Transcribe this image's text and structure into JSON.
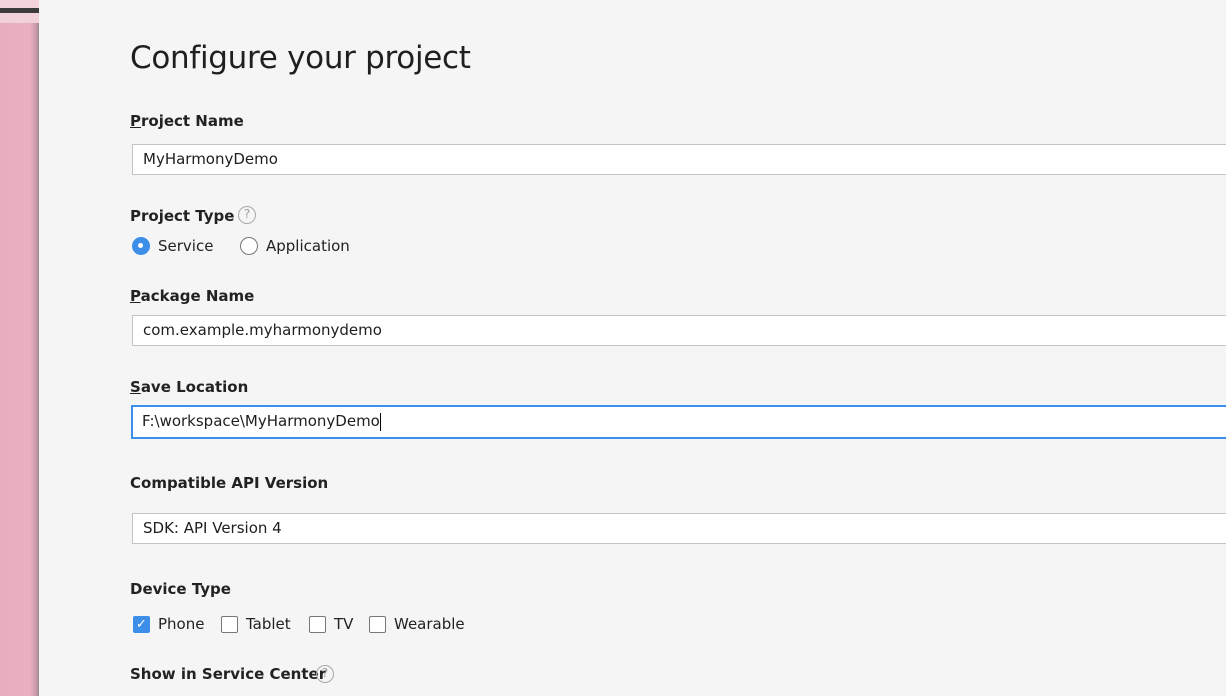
{
  "title": "Configure your project",
  "project_name": {
    "label": "Project Name",
    "value": "MyHarmonyDemo"
  },
  "project_type": {
    "label": "Project Type",
    "help_icon": "question-circle-icon",
    "options": [
      {
        "label": "Service",
        "selected": true
      },
      {
        "label": "Application",
        "selected": false
      }
    ]
  },
  "package_name": {
    "label": "Package Name",
    "value": "com.example.myharmonydemo"
  },
  "save_location": {
    "label": "Save Location",
    "value": "F:\\workspace\\MyHarmonyDemo"
  },
  "api_version": {
    "label": "Compatible API Version",
    "value": "SDK: API Version 4"
  },
  "device_type": {
    "label": "Device Type",
    "options": [
      {
        "label": "Phone",
        "checked": true
      },
      {
        "label": "Tablet",
        "checked": false
      },
      {
        "label": "TV",
        "checked": false
      },
      {
        "label": "Wearable",
        "checked": false
      }
    ]
  },
  "service_center": {
    "label": "Show in Service Center",
    "help_icon": "question-circle-icon"
  },
  "colors": {
    "accent": "#3d8ee8",
    "background": "#f5f5f5"
  }
}
